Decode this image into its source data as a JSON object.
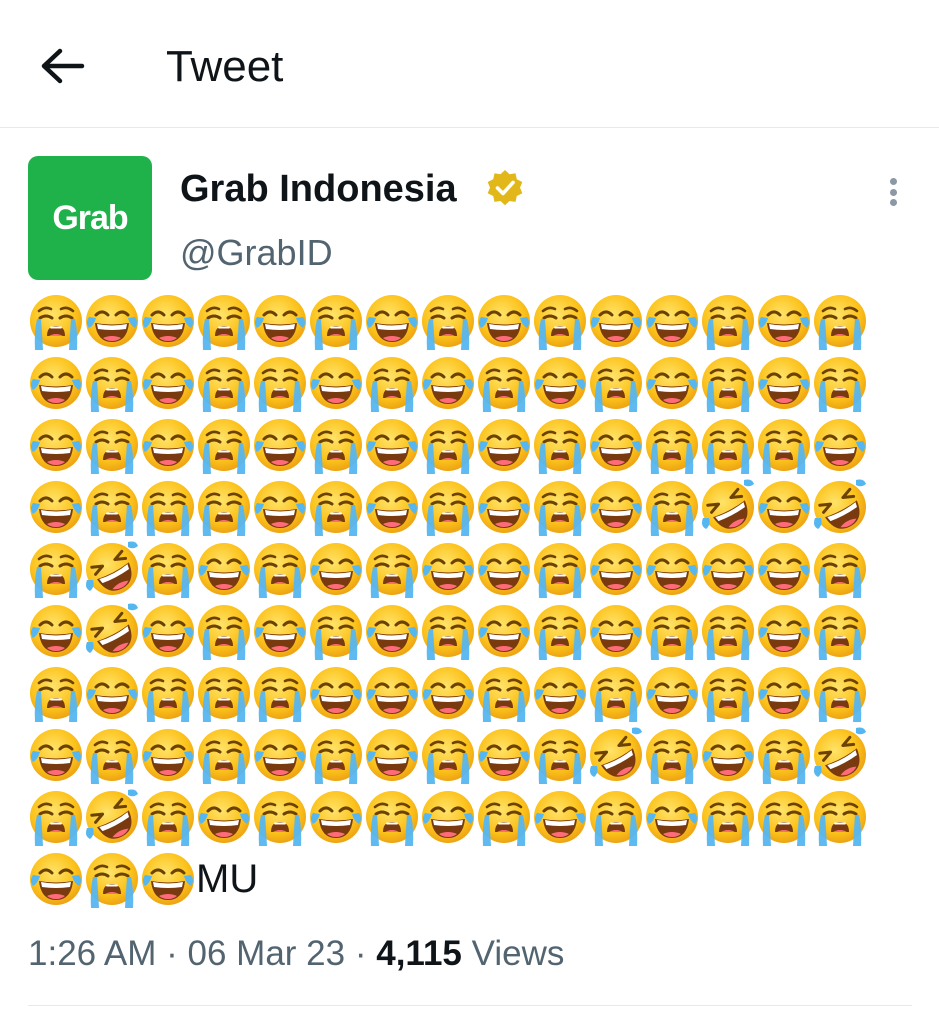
{
  "header": {
    "title": "Tweet",
    "back_icon": "arrow-left-icon"
  },
  "author": {
    "avatar_text": "Grab",
    "avatar_color": "#1fb24a",
    "name": "Grab Indonesia",
    "handle": "@GrabID",
    "verified_icon": "gold-verified-badge-icon",
    "verified_color": "#e2b719"
  },
  "more_icon": "more-vertical-icon",
  "tweet": {
    "emoji_legend": {
      "C": "loudly-crying-face",
      "J": "face-with-tears-of-joy",
      "R": "rolling-on-the-floor-laughing"
    },
    "emoji_rows": [
      "CJJCJCJCJCJJCJC",
      "JCJCCJCJCJCJCJC",
      "JCJCJCJCJCJCCCJ",
      "JCCCJCJCJCJCRJR",
      "CRCJCJCJJCJJJJC",
      "JRJCJCJCJCJCCJC",
      "CJCCCJJJCJCJCJC",
      "JCJCJCJCJCRCJCR",
      "CRCJCJCJCJCJCCC",
      "JCJ"
    ],
    "trailing_text": "MU"
  },
  "meta": {
    "time": "1:26 AM",
    "sep1": " · ",
    "date": "06 Mar 23",
    "sep2": " · ",
    "views_count": "4,115",
    "views_label": " Views"
  }
}
